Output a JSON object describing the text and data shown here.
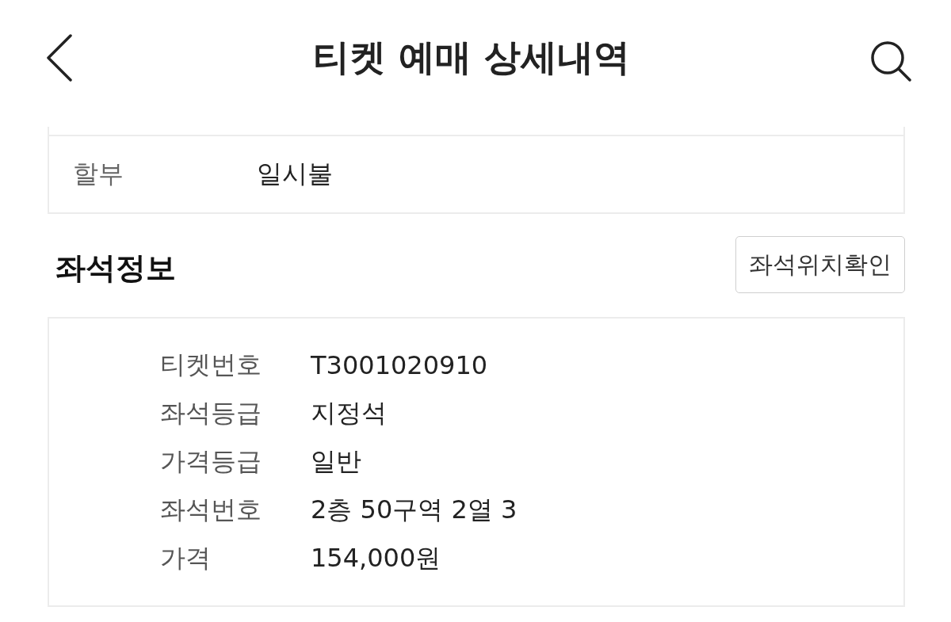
{
  "header": {
    "title": "티켓 예매 상세내역"
  },
  "payment_card": {
    "rows": [
      {
        "label": "할부",
        "value": "일시불"
      }
    ]
  },
  "seat_section": {
    "title": "좌석정보",
    "button": "좌석위치확인",
    "rows": [
      {
        "label": "티켓번호",
        "value": "T3001020910"
      },
      {
        "label": "좌석등급",
        "value": "지정석"
      },
      {
        "label": "가격등급",
        "value": "일반"
      },
      {
        "label": "좌석번호",
        "value": "2층 50구역 2열 3"
      },
      {
        "label": "가격",
        "value": "154,000원"
      }
    ]
  }
}
